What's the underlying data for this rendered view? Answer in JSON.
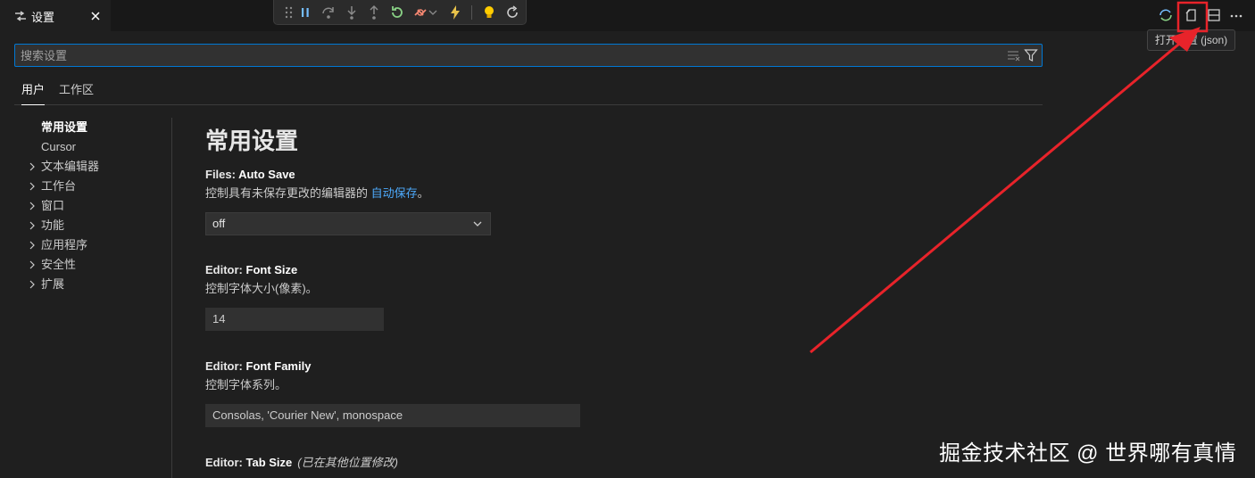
{
  "tab": {
    "label": "设置",
    "icon": "settings-sliders-icon",
    "close_icon": "close-icon"
  },
  "debug_toolbar": {
    "icons": [
      "drag-handle-icon",
      "pause-icon",
      "step-over-icon",
      "step-into-icon",
      "step-out-icon",
      "restart-icon",
      "disconnect-icon",
      "chevron-down-icon",
      "lightning-icon",
      "lightbulb-icon",
      "refresh-icon"
    ],
    "colors": {
      "restart": "#89d185",
      "disconnect": "#f48771",
      "lightning": "#e8c24a",
      "lightbulb": "#ffcc00"
    }
  },
  "editor_actions": {
    "icons": [
      "sync-icon",
      "open-settings-json-icon",
      "split-editor-icon",
      "more-icon"
    ],
    "tooltip": "打开设置 (json)"
  },
  "search": {
    "placeholder": "搜索设置"
  },
  "scopes": [
    {
      "label": "用户",
      "active": true
    },
    {
      "label": "工作区",
      "active": false
    }
  ],
  "toc": {
    "items": [
      {
        "label": "常用设置",
        "expandable": false,
        "active": true
      },
      {
        "label": "Cursor",
        "expandable": false,
        "active": false
      },
      {
        "label": "文本编辑器",
        "expandable": true,
        "active": false
      },
      {
        "label": "工作台",
        "expandable": true,
        "active": false
      },
      {
        "label": "窗口",
        "expandable": true,
        "active": false
      },
      {
        "label": "功能",
        "expandable": true,
        "active": false
      },
      {
        "label": "应用程序",
        "expandable": true,
        "active": false
      },
      {
        "label": "安全性",
        "expandable": true,
        "active": false
      },
      {
        "label": "扩展",
        "expandable": true,
        "active": false
      }
    ]
  },
  "main": {
    "section_title": "常用设置",
    "settings": [
      {
        "category": "Files: ",
        "key": "Auto Save",
        "desc_prefix": "控制具有未保存更改的编辑器的 ",
        "desc_link": "自动保存",
        "desc_suffix": "。",
        "value": "off",
        "control": "select"
      },
      {
        "category": "Editor: ",
        "key": "Font Size",
        "description": "控制字体大小(像素)。",
        "value": "14",
        "control": "input"
      },
      {
        "category": "Editor: ",
        "key": "Font Family",
        "description": "控制字体系列。",
        "value": "Consolas, 'Courier New', monospace",
        "control": "input"
      },
      {
        "category": "Editor: ",
        "key": "Tab Size",
        "modified": "(已在其他位置修改)"
      }
    ]
  },
  "watermark": "掘金技术社区 @ 世界哪有真情",
  "colors": {
    "accent": "#0078d4",
    "link": "#4daafc",
    "annotation": "#e8232a",
    "background": "#1f1f1f"
  }
}
